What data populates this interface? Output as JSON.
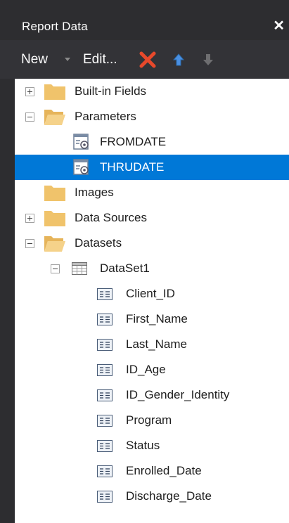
{
  "window": {
    "title": "Report Data",
    "close_glyph": "✕"
  },
  "toolbar": {
    "new_label": "New",
    "edit_label": "Edit...",
    "delete_icon": "delete-icon",
    "up_icon": "move-up-icon",
    "down_icon": "move-down-icon"
  },
  "tree": {
    "builtin_fields": "Built-in Fields",
    "parameters": "Parameters",
    "param_fromdate": "FROMDATE",
    "param_thrudate": "THRUDATE",
    "images": "Images",
    "data_sources": "Data Sources",
    "datasets": "Datasets",
    "dataset1": "DataSet1",
    "fields": [
      "Client_ID",
      "First_Name",
      "Last_Name",
      "ID_Age",
      "ID_Gender_Identity",
      "Program",
      "Status",
      "Enrolled_Date",
      "Discharge_Date"
    ]
  },
  "colors": {
    "selection": "#0078d7",
    "delete": "#e8492b",
    "arrow_up": "#4a90e2"
  }
}
